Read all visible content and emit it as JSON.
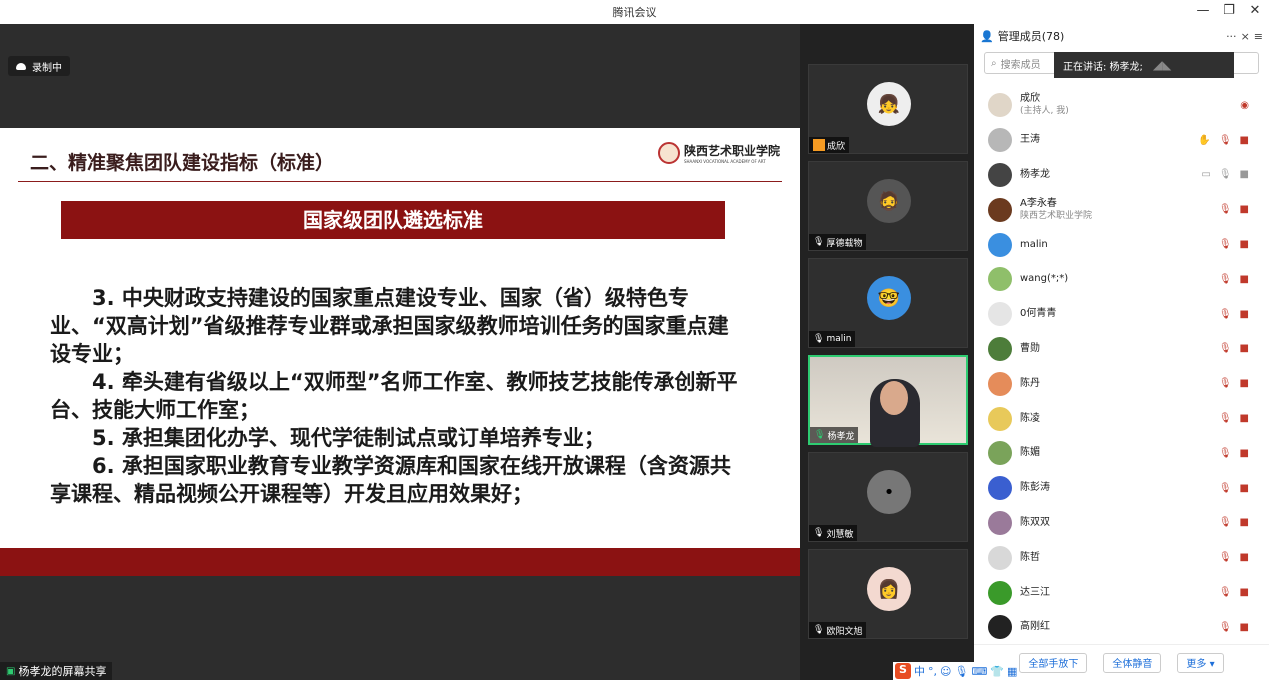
{
  "window": {
    "title": "腾讯会议"
  },
  "recording": {
    "label": "录制中"
  },
  "slide": {
    "title": "二、精准聚焦团队建设指标（标准）",
    "school_name": "陕西艺术职业学院",
    "school_en": "SHAANXI VOCATIONAL ACADEMY OF ART",
    "banner": "国家级团队遴选标准",
    "paragraphs": [
      "　　3. 中央财政支持建设的国家重点建设专业、国家（省）级特色专业、“双高计划”省级推荐专业群或承担国家级教师培训任务的国家重点建设专业；",
      "　　4. 牵头建有省级以上“双师型”名师工作室、教师技艺技能传承创新平台、技能大师工作室；",
      "　　5. 承担集团化办学、现代学徒制试点或订单培养专业；",
      "　　6. 承担国家职业教育专业教学资源库和国家在线开放课程（含资源共享课程、精品视频公开课程等）开发且应用效果好；"
    ]
  },
  "share_label": "杨孝龙的屏幕共享",
  "video_tiles": [
    {
      "name": "成欣"
    },
    {
      "name": "厚德载物"
    },
    {
      "name": "malin"
    },
    {
      "name": "杨孝龙"
    },
    {
      "name": "刘慧敏"
    },
    {
      "name": "欧阳文旭"
    }
  ],
  "members_panel": {
    "title": "管理成员(78)",
    "more": "···",
    "close": "×",
    "menu": "≡",
    "search_placeholder": "搜索成员",
    "speaking": "正在讲话: 杨孝龙;",
    "members": [
      {
        "name": "成欣",
        "sub": "(主持人, 我)"
      },
      {
        "name": "王涛",
        "sub": ""
      },
      {
        "name": "杨孝龙",
        "sub": ""
      },
      {
        "name": "A李永春",
        "sub": "陕西艺术职业学院"
      },
      {
        "name": "malin",
        "sub": ""
      },
      {
        "name": "wang(*;*)",
        "sub": ""
      },
      {
        "name": "0何青青",
        "sub": ""
      },
      {
        "name": "曹勋",
        "sub": ""
      },
      {
        "name": "陈丹",
        "sub": ""
      },
      {
        "name": "陈凌",
        "sub": ""
      },
      {
        "name": "陈媚",
        "sub": ""
      },
      {
        "name": "陈彭涛",
        "sub": ""
      },
      {
        "name": "陈双双",
        "sub": ""
      },
      {
        "name": "陈哲",
        "sub": ""
      },
      {
        "name": "达三江",
        "sub": ""
      },
      {
        "name": "高刚红",
        "sub": ""
      }
    ],
    "footer": {
      "lower_hands": "全部手放下",
      "mute_all": "全体静音",
      "more": "更多 ▾"
    }
  },
  "ime": {
    "logo": "S",
    "mode": "中",
    "punct": "°,"
  }
}
